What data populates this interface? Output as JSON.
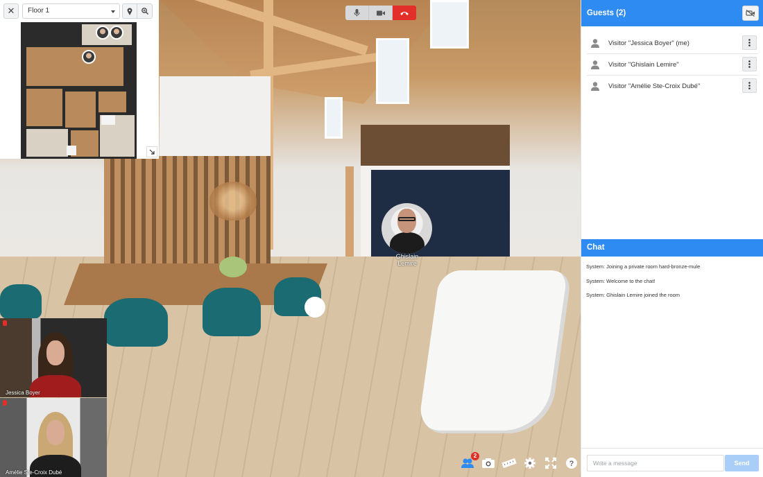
{
  "floorplan": {
    "close_icon": "close-icon",
    "floor_select": {
      "value": "Floor 1"
    },
    "buttons": [
      "map-pin-icon",
      "zoom-in-icon"
    ],
    "expand_icon": "expand-icon"
  },
  "media_controls": {
    "buttons": [
      {
        "name": "microphone",
        "icon": "microphone-icon",
        "active": false
      },
      {
        "name": "camera",
        "icon": "video-camera-icon",
        "active": false
      },
      {
        "name": "end-call",
        "icon": "phone-hangup-icon",
        "active": true
      }
    ],
    "active_color": "#e22f2a"
  },
  "remote_participant": {
    "name": "Ghislain\nLemire"
  },
  "local_videos": [
    {
      "name": "Jessica Boyer",
      "muted": true
    },
    {
      "name": "Amélie Ste-Croix Dubé",
      "muted": true
    }
  ],
  "tools": {
    "items": [
      "participants-icon",
      "camera-snapshot-icon",
      "measure-ruler-icon",
      "settings-gear-icon",
      "fullscreen-icon",
      "help-icon"
    ],
    "participants_badge": "2"
  },
  "guests": {
    "title": "Guests (2)",
    "toggle_icon": "video-off-icon",
    "list": [
      {
        "name": "Visitor \"Jessica Boyer\" (me)"
      },
      {
        "name": "Visitor \"Ghislain Lemire\""
      },
      {
        "name": "Visitor \"Amélie Ste-Croix Dubé\""
      }
    ]
  },
  "chat": {
    "title": "Chat",
    "messages": [
      "System: Joining a private room hard-bronze-mule",
      "System: Welcome to the chat!",
      "System: Ghislain Lemire joined the room"
    ],
    "input_placeholder": "Write a message",
    "send_label": "Send"
  },
  "colors": {
    "accent": "#2e8bf2",
    "danger": "#e22f2a"
  }
}
